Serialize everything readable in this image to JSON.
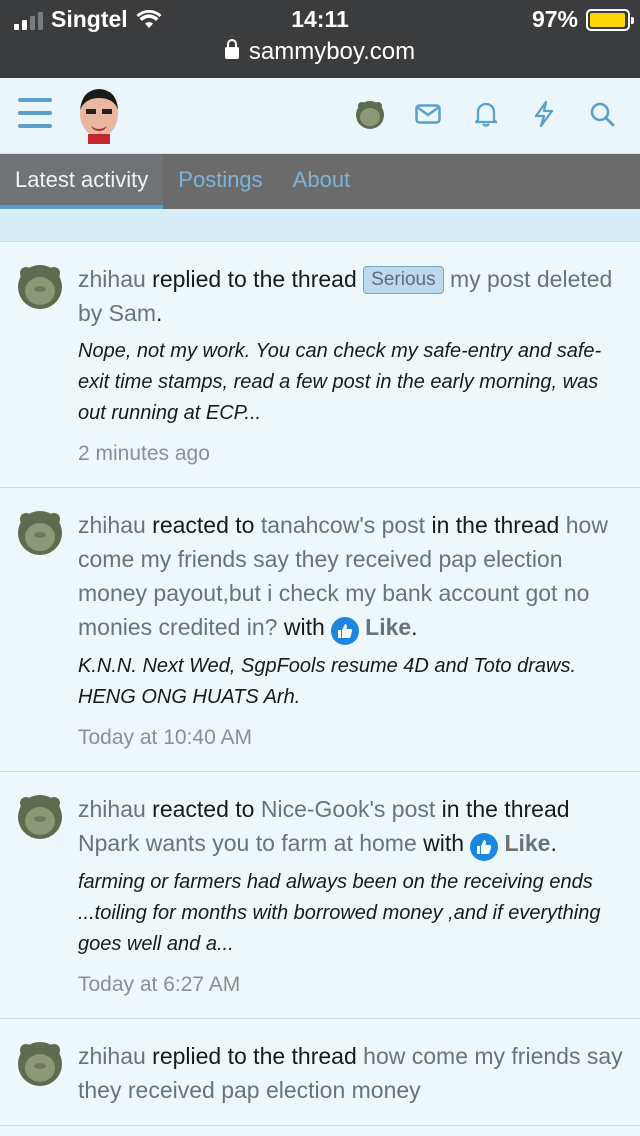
{
  "status": {
    "carrier": "Singtel",
    "time": "14:11",
    "battery": "97%",
    "battery_level": 0.97
  },
  "browser": {
    "url": "sammyboy.com"
  },
  "tabs": [
    {
      "label": "Latest activity"
    },
    {
      "label": "Postings"
    },
    {
      "label": "About"
    }
  ],
  "icons": {
    "menu": "hamburger-icon",
    "mail": "mail-icon",
    "bell": "bell-icon",
    "bolt": "bolt-icon",
    "search": "search-icon"
  },
  "colors": {
    "accent": "#5b9ec9",
    "like": "#1b86e0",
    "tab_bar": "#6b6b6b"
  },
  "feed": [
    {
      "user": "zhihau",
      "action": "replied to the thread",
      "prefix": "Serious",
      "thread": "my post deleted by Sam",
      "end": ".",
      "snippet": "Nope, not my work. You can check my safe-entry and safe-exit time stamps, read a few post in the early morning, was out running at ECP...",
      "time": "2 minutes ago"
    },
    {
      "user": "zhihau",
      "action": "reacted to",
      "post": "tanahcow's post",
      "mid": "in the thread",
      "thread": "how come my friends say they received pap election money payout,but i check my bank account got no monies credited in?",
      "with": "with",
      "reaction": "Like",
      "end": ".",
      "snippet": "K.N.N. Next Wed, SgpFools resume 4D and Toto draws. HENG ONG HUATS Arh.",
      "time": "Today at 10:40 AM"
    },
    {
      "user": "zhihau",
      "action": "reacted to",
      "post": "Nice-Gook's post",
      "mid": "in the thread",
      "thread": "Npark wants you to farm at home",
      "with": "with",
      "reaction": "Like",
      "end": ".",
      "snippet": "farming or farmers had always been on the receiving ends ...toiling for months with borrowed money ,and if everything goes well and a...",
      "time": "Today at 6:27 AM"
    },
    {
      "user": "zhihau",
      "action": "replied to the thread",
      "thread": "how come my friends say they received pap election money"
    }
  ]
}
